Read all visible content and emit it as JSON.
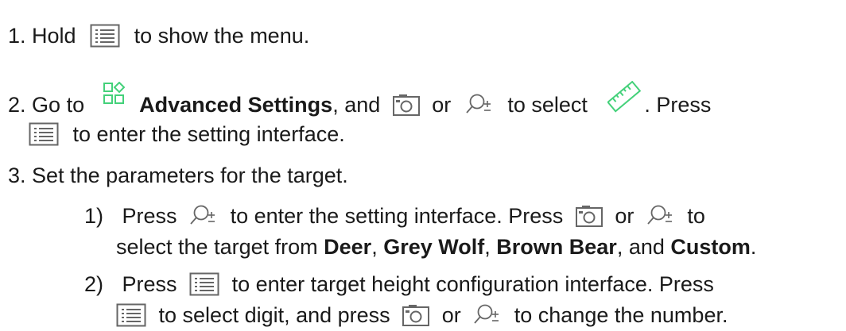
{
  "steps": {
    "s1": {
      "num": "1.",
      "a": "Hold",
      "b": "to show the menu."
    },
    "s2": {
      "num": "2.",
      "a": "Go to",
      "bold": "Advanced Settings",
      "b": ", and",
      "c": "or",
      "d": "to select",
      "e": ". Press",
      "f": "to enter the setting interface."
    },
    "s3": {
      "num": "3.",
      "text": "Set the parameters for the target."
    },
    "sub1": {
      "num": "1)",
      "a": "Press",
      "b": "to enter the setting interface. Press",
      "c": "or",
      "d": "to",
      "e": "select the target from",
      "deer": "Deer",
      "comma1": ",",
      "wolf": "Grey Wolf",
      "comma2": ",",
      "bear": "Brown Bear",
      "and": ", and",
      "custom": "Custom",
      "period": "."
    },
    "sub2": {
      "num": "2)",
      "a": "Press",
      "b": "to enter target height configuration interface. Press",
      "c": "to select digit, and press",
      "d": "or",
      "e": "to change the number."
    }
  },
  "icons": {
    "menu": "menu-button-icon",
    "camera": "camera-button-icon",
    "zoom": "zoom-button-icon",
    "advanced": "advanced-settings-icon",
    "ruler": "ruler-icon"
  },
  "colors": {
    "accent": "#44d17a",
    "text": "#1a1a1a",
    "icon": "#666666"
  }
}
